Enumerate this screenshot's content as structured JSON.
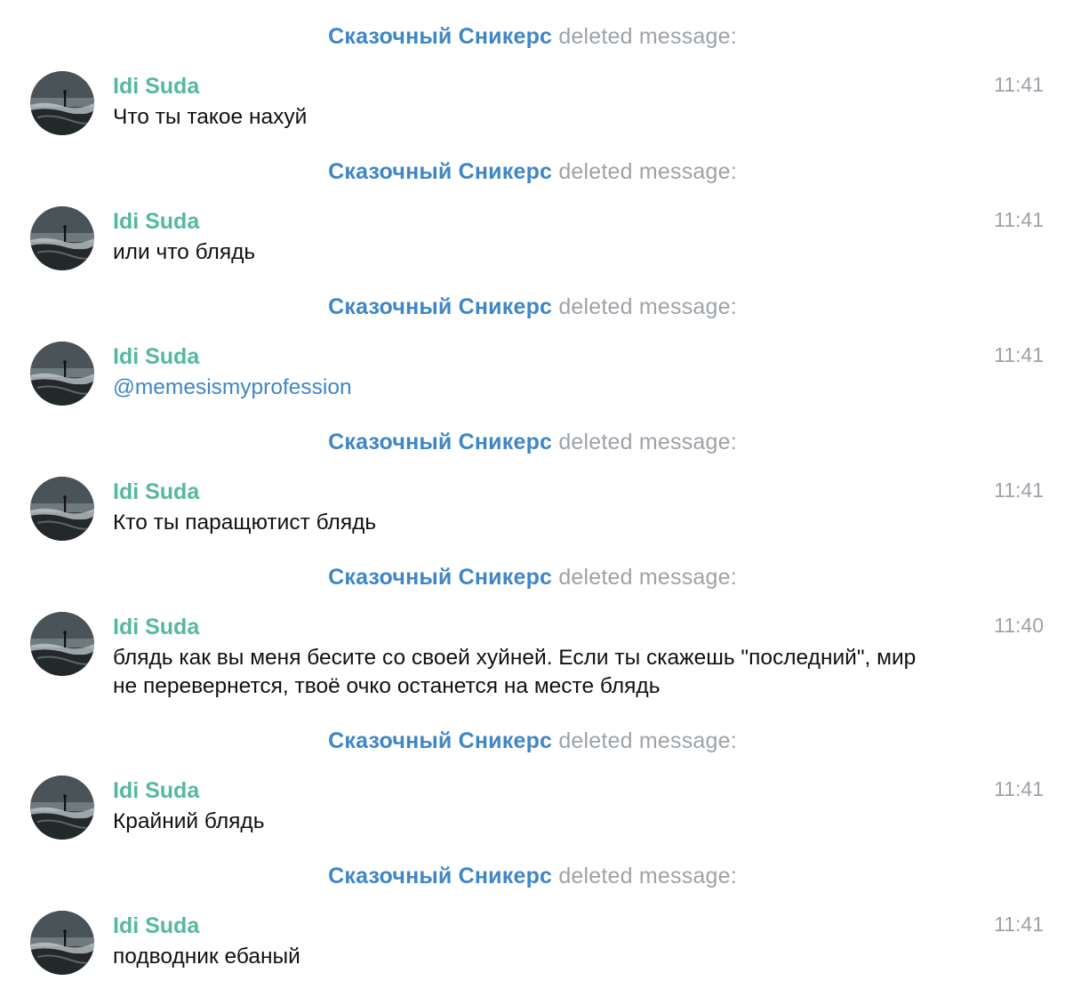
{
  "service_events": [
    {
      "actor": "Сказочный Сникерс",
      "action": "deleted message:"
    },
    {
      "actor": "Сказочный Сникерс",
      "action": "deleted message:"
    },
    {
      "actor": "Сказочный Сникерс",
      "action": "deleted message:"
    },
    {
      "actor": "Сказочный Сникерс",
      "action": "deleted message:"
    },
    {
      "actor": "Сказочный Сникерс",
      "action": "deleted message:"
    },
    {
      "actor": "Сказочный Сникерс",
      "action": "deleted message:"
    },
    {
      "actor": "Сказочный Сникерс",
      "action": "deleted message:"
    }
  ],
  "messages": [
    {
      "author": "Idi Suda",
      "time": "11:41",
      "text": "Что ты такое нахуй"
    },
    {
      "author": "Idi Suda",
      "time": "11:41",
      "text": "или что блядь"
    },
    {
      "author": "Idi Suda",
      "time": "11:41",
      "text": "@memesismyprofession"
    },
    {
      "author": "Idi Suda",
      "time": "11:41",
      "text": "Кто ты паращютист блядь"
    },
    {
      "author": "Idi Suda",
      "time": "11:40",
      "text": "блядь как вы меня бесите со своей хуйней. Если ты скажешь \"последний\", мир не перевернется, твоё очко останется на месте блядь"
    },
    {
      "author": "Idi Suda",
      "time": "11:41",
      "text": "Крайний блядь"
    },
    {
      "author": "Idi Suda",
      "time": "11:41",
      "text": "подводник ебаный"
    }
  ],
  "colors": {
    "actor_blue": "#3f86c7",
    "author_green": "#55b9a0",
    "meta_gray": "#9ea3a8",
    "text": "#111111",
    "background": "#ffffff"
  },
  "icons": {
    "avatar": "sea-rock-photo-avatar"
  }
}
